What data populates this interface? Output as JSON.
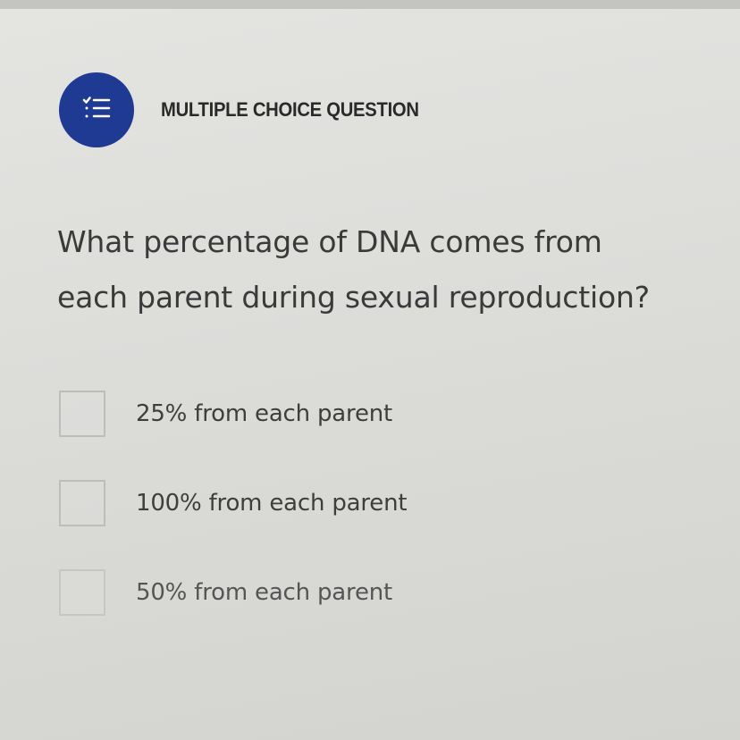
{
  "question": {
    "type_label": "MULTIPLE CHOICE QUESTION",
    "type_icon": "checklist-icon",
    "accent_color": "#1f3a93",
    "text_line1": "What percentage of DNA comes from",
    "text_line2": "each parent during sexual reproduction?"
  },
  "choices": [
    {
      "label": "25% from each parent",
      "checked": false
    },
    {
      "label": "100% from each parent",
      "checked": false
    },
    {
      "label": "50% from each parent",
      "checked": false
    }
  ]
}
